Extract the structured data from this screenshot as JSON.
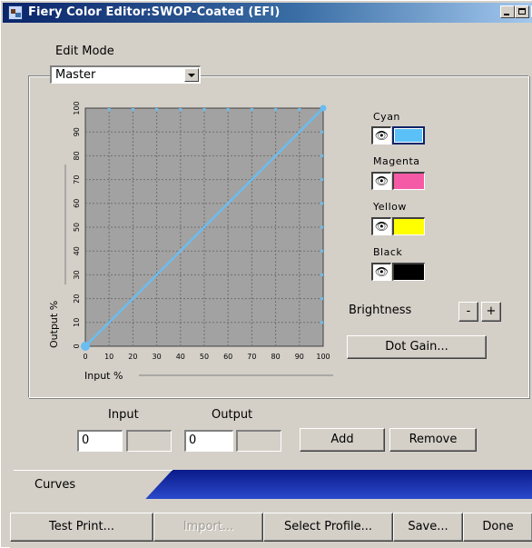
{
  "window": {
    "title": "Fiery Color Editor:SWOP-Coated (EFI)",
    "minimize_glyph": "",
    "maximize_glyph": "",
    "close_glyph": "×"
  },
  "edit_mode": {
    "label": "Edit Mode",
    "value": "Master"
  },
  "chart": {
    "xlabel": "Input %",
    "ylabel": "Output %",
    "x_ticks": [
      "0",
      "10",
      "20",
      "30",
      "40",
      "50",
      "60",
      "70",
      "80",
      "90",
      "100"
    ],
    "y_ticks": [
      "0",
      "10",
      "20",
      "30",
      "40",
      "50",
      "60",
      "70",
      "80",
      "90",
      "100"
    ]
  },
  "chart_data": {
    "type": "line",
    "xlabel": "Input %",
    "ylabel": "Output %",
    "xlim": [
      0,
      100
    ],
    "ylim": [
      0,
      100
    ],
    "grid": true,
    "series": [
      {
        "name": "Cyan",
        "color": "#69bdf0",
        "x": [
          0,
          100
        ],
        "y": [
          0,
          100
        ]
      }
    ]
  },
  "channels": [
    {
      "name": "Cyan",
      "color": "#5bc0f8",
      "eye_glyph": "👁"
    },
    {
      "name": "Magenta",
      "color": "#f45aa6",
      "eye_glyph": "👁"
    },
    {
      "name": "Yellow",
      "color": "#ffff00",
      "eye_glyph": "👁"
    },
    {
      "name": "Black",
      "color": "#000000",
      "eye_glyph": "👁"
    }
  ],
  "brightness": {
    "label": "Brightness",
    "minus": "-",
    "plus": "+"
  },
  "dot_gain_label": "Dot Gain...",
  "point_editor": {
    "input_label": "Input",
    "output_label": "Output",
    "input_value": "0",
    "input_value2": "",
    "output_value": "0",
    "output_value2": "",
    "add_label": "Add",
    "remove_label": "Remove"
  },
  "tabs": [
    {
      "label": "Curves"
    }
  ],
  "bottom_buttons": {
    "test_print": "Test Print...",
    "import": "Import...",
    "select_profile": "Select Profile...",
    "save": "Save...",
    "done": "Done"
  }
}
